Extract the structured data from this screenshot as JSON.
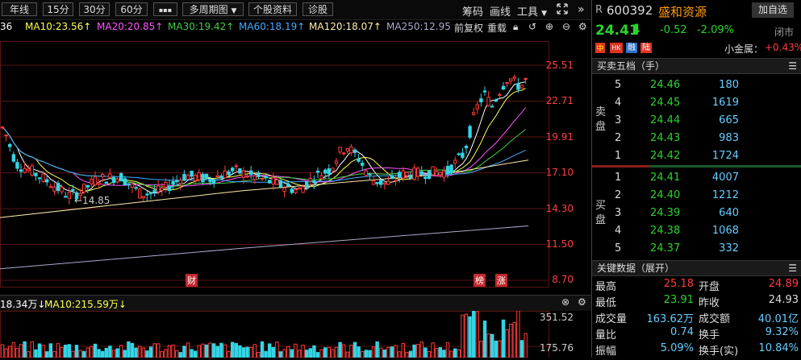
{
  "toolbar": {
    "period_daily": "年线",
    "period_15": "15分",
    "period_30": "30分",
    "period_60": "60分",
    "more": "▪▪▪",
    "multi": "多周期图",
    "profile": "个股资料",
    "diagnose": "诊股",
    "chips": "筹码",
    "draw": "画线",
    "tools": "工具",
    "expand_icon": "expand-icon",
    "double_arrow": "»"
  },
  "ma": {
    "ma5": "36",
    "ma10": "MA10:23.56↑",
    "ma20": "MA20:20.85↑",
    "ma30": "MA30:19.42↑",
    "ma60": "MA60:18.19↑",
    "ma120": "MA120:18.07↑",
    "ma250": "MA250:12.95",
    "adjust": "前复权",
    "overlay": "重载",
    "colors": {
      "ma5": "#ffffff",
      "ma10": "#ffff55",
      "ma20": "#ff55ff",
      "ma30": "#44cc44",
      "ma60": "#44aaff",
      "ma120": "#ffeeaa",
      "ma250": "#aaaacc"
    }
  },
  "chart": {
    "y_labels": [
      "25.51",
      "22.71",
      "19.91",
      "17.10",
      "14.30",
      "11.50",
      "8.70"
    ],
    "low_marker": "←14.85",
    "event_cai": "财",
    "event_bang": "榜",
    "event_zhang": "涨"
  },
  "volume": {
    "ma5": "18.34万↓",
    "ma10": "MA10:215.59万↓",
    "y_labels": [
      "351.52",
      "175.76"
    ]
  },
  "stock": {
    "prefix": "R",
    "code": "600392",
    "name": "盛和资源",
    "add_watch": "加自选",
    "price": "24.41",
    "change": "-0.52",
    "pct": "-2.09%",
    "status": "闭市",
    "tags": [
      "中",
      "HK",
      "融",
      "陆"
    ],
    "mini": "小金属：",
    "mini_pct": "+0.43%"
  },
  "orderbook": {
    "title": "买卖五档（手）",
    "sell_label": "卖盘",
    "buy_label": "买盘",
    "sell": [
      {
        "level": "5",
        "price": "24.46",
        "vol": "180"
      },
      {
        "level": "4",
        "price": "24.45",
        "vol": "1619"
      },
      {
        "level": "3",
        "price": "24.44",
        "vol": "665"
      },
      {
        "level": "2",
        "price": "24.43",
        "vol": "983"
      },
      {
        "level": "1",
        "price": "24.42",
        "vol": "1724"
      }
    ],
    "buy": [
      {
        "level": "1",
        "price": "24.41",
        "vol": "4007"
      },
      {
        "level": "2",
        "price": "24.40",
        "vol": "1212"
      },
      {
        "level": "3",
        "price": "24.39",
        "vol": "640"
      },
      {
        "level": "4",
        "price": "24.38",
        "vol": "1068"
      },
      {
        "level": "5",
        "price": "24.37",
        "vol": "332"
      }
    ]
  },
  "keydata": {
    "title": "关键数据（展开）",
    "rows": [
      {
        "l1": "最高",
        "v1": "25.18",
        "l2": "开盘",
        "v2": "24.89"
      },
      {
        "l1": "最低",
        "v1": "23.91",
        "l2": "昨收",
        "v2": "24.93"
      },
      {
        "l1": "成交量",
        "v1": "163.62万",
        "l2": "成交额",
        "v2": "40.01亿"
      },
      {
        "l1": "量比",
        "v1": "0.74",
        "l2": "换手",
        "v2": "9.32%"
      },
      {
        "l1": "振幅",
        "v1": "5.09%",
        "l2": "换手(实)",
        "v2": "10.84%"
      }
    ]
  }
}
